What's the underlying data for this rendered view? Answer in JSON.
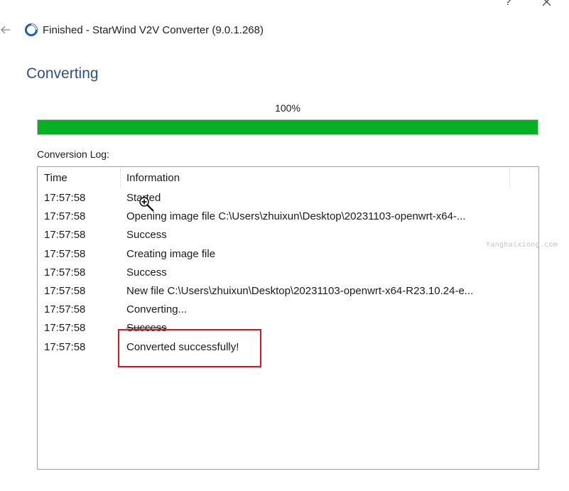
{
  "window": {
    "title": "Finished - StarWind V2V Converter (9.0.1.268)",
    "help_glyph": "?",
    "close_icon": "close-icon",
    "back_icon": "back-arrow-icon",
    "logo_icon": "starwind-logo-icon"
  },
  "page": {
    "heading": "Converting"
  },
  "progress": {
    "label": "100%",
    "value": 100,
    "color": "#06b025"
  },
  "log": {
    "label": "Conversion Log:",
    "columns": {
      "time": "Time",
      "information": "Information"
    },
    "rows": [
      {
        "time": "17:57:58",
        "info": "Started"
      },
      {
        "time": "17:57:58",
        "info": "Opening image file C:\\Users\\zhuixun\\Desktop\\20231103-openwrt-x64-..."
      },
      {
        "time": "17:57:58",
        "info": "Success"
      },
      {
        "time": "17:57:58",
        "info": "Creating image file"
      },
      {
        "time": "17:57:58",
        "info": "Success"
      },
      {
        "time": "17:57:58",
        "info": "New file C:\\Users\\zhuixun\\Desktop\\20231103-openwrt-x64-R23.10.24-e..."
      },
      {
        "time": "17:57:58",
        "info": "Converting..."
      },
      {
        "time": "17:57:58",
        "info": "Success"
      },
      {
        "time": "17:57:58",
        "info": "Converted successfully!"
      }
    ]
  },
  "annotation": {
    "highlight_color": "#e0141e"
  },
  "watermark": "Yanghaixiong.com"
}
